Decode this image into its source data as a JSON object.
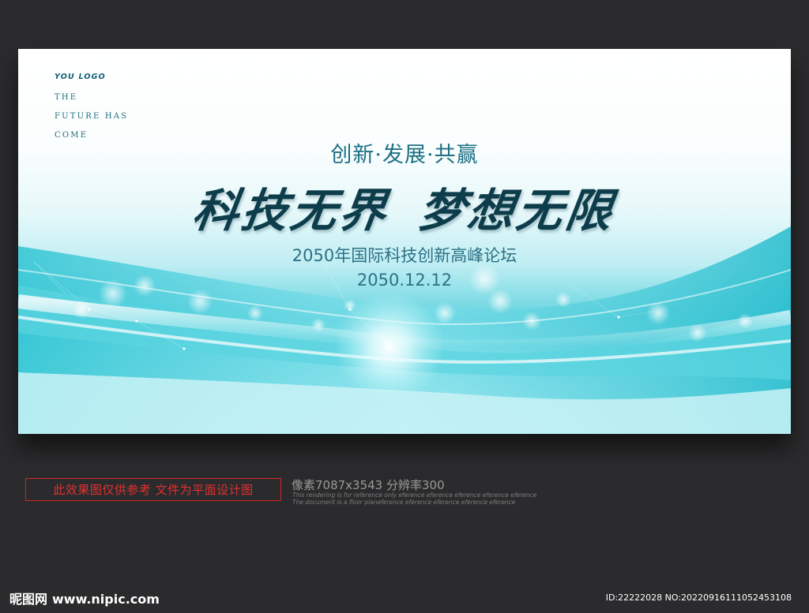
{
  "logo": {
    "text": "YOU LOGO",
    "lines": [
      "THE",
      "FUTURE HAS",
      "COME"
    ]
  },
  "banner": {
    "slogan": "创新·发展·共赢",
    "headline_left": "科技无界",
    "headline_right": "梦想无限",
    "forum_title": "2050年国际科技创新高峰论坛",
    "date": "2050.12.12"
  },
  "footer": {
    "notice": "此效果图仅供参考 文件为平面设计图",
    "spec": "像素7087x3543  分辨率300",
    "fine_print_1": "This rendering is for reference only  eference eference eference eference eference",
    "fine_print_2": "The document is a floor planeference eference eference eference eference",
    "watermark_cn": "昵图网",
    "watermark_url": "www.nipic.com",
    "id_line": "ID:22222028 NO:20220916111052453108"
  },
  "colors": {
    "background": "#2b2b2d",
    "teal_dark": "#0d3d4b",
    "teal_text": "#2c7185",
    "cyan": "#3fcbd9",
    "notice_red": "#d32424"
  }
}
